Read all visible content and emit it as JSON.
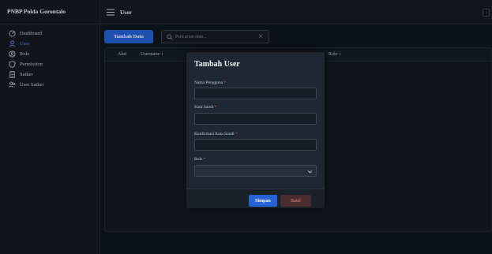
{
  "app": {
    "brand": "PNBP Polda Gorontalo"
  },
  "sidebar": {
    "items": [
      {
        "label": "Dashboard",
        "icon": "dashboard-icon",
        "active": false
      },
      {
        "label": "User",
        "icon": "user-icon",
        "active": true
      },
      {
        "label": "Role",
        "icon": "role-icon",
        "active": false
      },
      {
        "label": "Permission",
        "icon": "shield-icon",
        "active": false
      },
      {
        "label": "Satker",
        "icon": "building-icon",
        "active": false
      },
      {
        "label": "User Satker",
        "icon": "users-icon",
        "active": false
      }
    ]
  },
  "header": {
    "title": "User"
  },
  "toolbar": {
    "add_label": "Tambah Data",
    "search_placeholder": "Pencarian data...",
    "clear_symbol": "×"
  },
  "table": {
    "columns": [
      "Aksi",
      "Username ↕",
      "Role ↕"
    ]
  },
  "modal": {
    "title": "Tambah User",
    "fields": [
      {
        "label": "Nama Pengguna",
        "required": "*",
        "value": ""
      },
      {
        "label": "Kata Sandi",
        "required": "*",
        "value": ""
      },
      {
        "label": "Konfirmasi Kata Sandi",
        "required": "*",
        "value": ""
      },
      {
        "label": "Role",
        "required": "*",
        "value": ""
      }
    ],
    "save_label": "Simpan",
    "cancel_label": "Batal"
  },
  "colors": {
    "accent": "#2563d6",
    "active_nav": "#5b8df0",
    "cancel_text": "#e58a86",
    "background": "#11161c"
  }
}
